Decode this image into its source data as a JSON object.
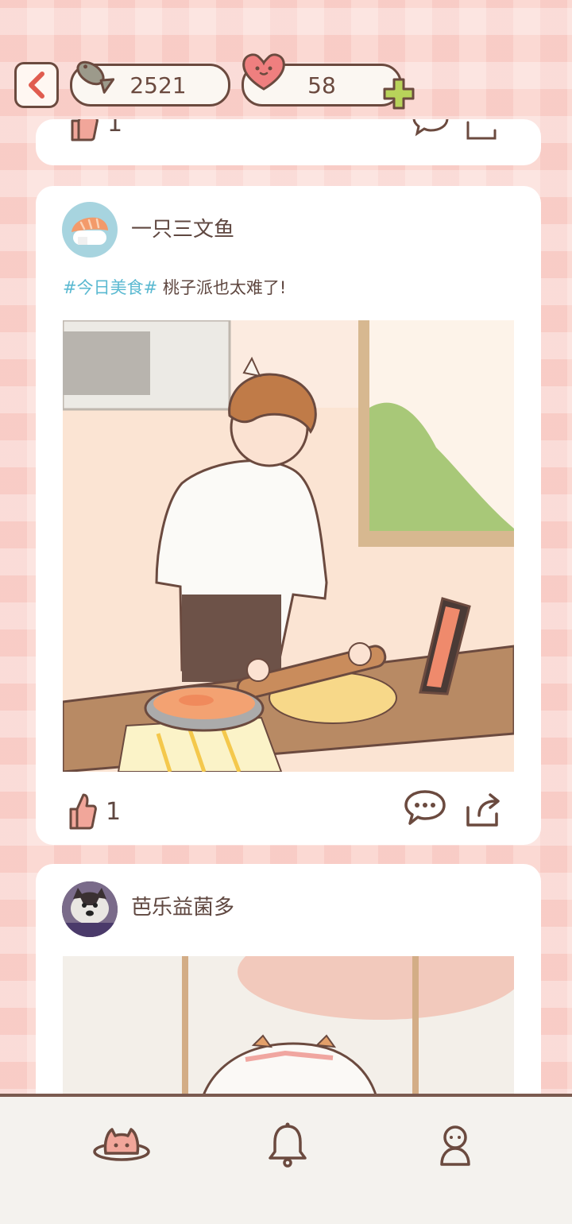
{
  "header": {
    "fish_count": "2521",
    "heart_count": "58"
  },
  "feed": {
    "previous_post": {
      "like_count": "1"
    },
    "post": {
      "username": "一只三文鱼",
      "hashtag": "#今日美食#",
      "text": "桃子派也太难了!",
      "like_count": "1"
    },
    "next_post": {
      "username": "芭乐益菌多"
    }
  },
  "colors": {
    "background": "#fbd9d3",
    "outline": "#6b4a3f",
    "hashtag": "#5ab9d1",
    "like_fill": "#f1a69a",
    "plus": "#b8d35a"
  },
  "icons": {
    "back": "chevron-left-icon",
    "currency": "fish-icon",
    "lives": "heart-icon",
    "add": "plus-icon",
    "like": "thumbs-up-icon",
    "comment": "speech-bubble-icon",
    "share": "share-icon",
    "nav_home": "cat-planet-icon",
    "nav_notifications": "bell-icon",
    "nav_profile": "person-icon"
  }
}
